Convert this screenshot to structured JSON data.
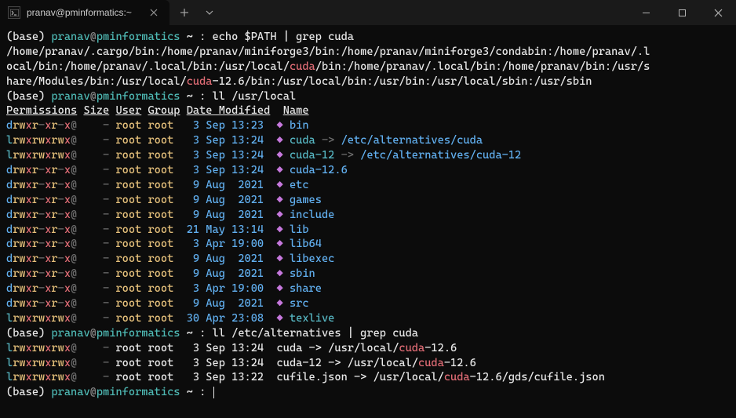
{
  "tab": {
    "title": "pranav@pminformatics:~"
  },
  "prompt": {
    "env": "(base)",
    "user": "pranav",
    "at": "@",
    "host": "pminformatics",
    "path": "~",
    "sep": ":"
  },
  "cmd1": "echo $PATH | grep cuda",
  "path_output": {
    "seg1": "/home/pranav/.cargo/bin:/home/pranav/miniforge3/bin:/home/pranav/miniforge3/condabin:/home/pranav/.l",
    "seg2a": "ocal/bin:/home/pranav/.local/bin:/usr/local/",
    "seg2b": "cuda",
    "seg2c": "/bin:/home/pranav/.local/bin:/home/pranav/bin:/usr/s",
    "seg3a": "hare/Modules/bin:/usr/local/",
    "seg3b": "cuda",
    "seg3c": "-12.6/bin:/usr/local/bin:/usr/bin:/usr/local/sbin:/usr/sbin"
  },
  "cmd2": "ll /usr/local",
  "headers": {
    "perms": "Permissions",
    "size": "Size",
    "user": "User",
    "group": "Group",
    "date": "Date Modified",
    "name": "Name"
  },
  "perm_drwx": {
    "d": "d",
    "rw": "rw",
    "x1": "x",
    "r2": "r",
    "dash2": "-",
    "x2": "x",
    "r3": "r",
    "dash3": "-",
    "x3": "x",
    "at": "@"
  },
  "perm_lrwx": {
    "l": "l",
    "rw": "rw",
    "x1": "x",
    "rw2": "rw",
    "x2": "x",
    "rw3": "rw",
    "x3": "x",
    "at": "@"
  },
  "rows": [
    {
      "type": "d",
      "size": "-",
      "user": "root",
      "group": "root",
      "daypad": " 3",
      "mon": "Sep",
      "time": "13:23",
      "name": "bin"
    },
    {
      "type": "l",
      "size": "-",
      "user": "root",
      "group": "root",
      "daypad": " 3",
      "mon": "Sep",
      "time": "13:24",
      "name": "cuda",
      "arrow": "->",
      "target": "/etc/alternatives/cuda"
    },
    {
      "type": "l",
      "size": "-",
      "user": "root",
      "group": "root",
      "daypad": " 3",
      "mon": "Sep",
      "time": "13:24",
      "name": "cuda-12",
      "arrow": "->",
      "target": "/etc/alternatives/cuda-12"
    },
    {
      "type": "d",
      "size": "-",
      "user": "root",
      "group": "root",
      "daypad": " 3",
      "mon": "Sep",
      "time": "13:24",
      "name": "cuda-12.6"
    },
    {
      "type": "d",
      "size": "-",
      "user": "root",
      "group": "root",
      "daypad": " 9",
      "mon": "Aug",
      "time": " 2021",
      "name": "etc"
    },
    {
      "type": "d",
      "size": "-",
      "user": "root",
      "group": "root",
      "daypad": " 9",
      "mon": "Aug",
      "time": " 2021",
      "name": "games"
    },
    {
      "type": "d",
      "size": "-",
      "user": "root",
      "group": "root",
      "daypad": " 9",
      "mon": "Aug",
      "time": " 2021",
      "name": "include"
    },
    {
      "type": "d",
      "size": "-",
      "user": "root",
      "group": "root",
      "daypad": "21",
      "mon": "May",
      "time": "13:14",
      "name": "lib"
    },
    {
      "type": "d",
      "size": "-",
      "user": "root",
      "group": "root",
      "daypad": " 3",
      "mon": "Apr",
      "time": "19:00",
      "name": "lib64"
    },
    {
      "type": "d",
      "size": "-",
      "user": "root",
      "group": "root",
      "daypad": " 9",
      "mon": "Aug",
      "time": " 2021",
      "name": "libexec"
    },
    {
      "type": "d",
      "size": "-",
      "user": "root",
      "group": "root",
      "daypad": " 9",
      "mon": "Aug",
      "time": " 2021",
      "name": "sbin"
    },
    {
      "type": "d",
      "size": "-",
      "user": "root",
      "group": "root",
      "daypad": " 3",
      "mon": "Apr",
      "time": "19:00",
      "name": "share"
    },
    {
      "type": "d",
      "size": "-",
      "user": "root",
      "group": "root",
      "daypad": " 9",
      "mon": "Aug",
      "time": " 2021",
      "name": "src"
    },
    {
      "type": "l",
      "size": "-",
      "user": "root",
      "group": "root",
      "daypad": "30",
      "mon": "Apr",
      "time": "23:08",
      "name": "texlive"
    }
  ],
  "cmd3": "ll /etc/alternatives | grep cuda",
  "alt_rows": [
    {
      "size": "-",
      "user": "root",
      "group": "root",
      "day": "3",
      "mon": "Sep",
      "time": "13:24",
      "name": "cuda",
      "arrow": "->",
      "tpre": "/usr/local/",
      "thl": "cuda",
      "tpost": "-12.6"
    },
    {
      "size": "-",
      "user": "root",
      "group": "root",
      "day": "3",
      "mon": "Sep",
      "time": "13:24",
      "name": "cuda-12",
      "arrow": "->",
      "tpre": "/usr/local/",
      "thl": "cuda",
      "tpost": "-12.6"
    },
    {
      "size": "-",
      "user": "root",
      "group": "root",
      "day": "3",
      "mon": "Sep",
      "time": "13:22",
      "name": "cufile.json",
      "arrow": "->",
      "tpre": "/usr/local/",
      "thl": "cuda",
      "tpost": "-12.6/gds/cufile.json"
    }
  ]
}
